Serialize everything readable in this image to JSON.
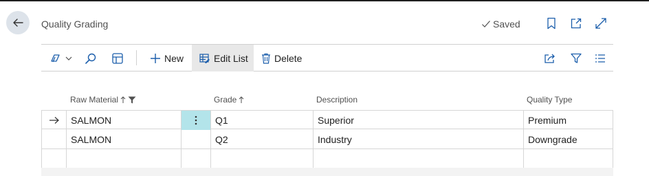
{
  "header": {
    "title": "Quality Grading",
    "saved_label": "Saved"
  },
  "toolbar": {
    "new_label": "New",
    "edit_list_label": "Edit List",
    "delete_label": "Delete"
  },
  "table": {
    "columns": [
      {
        "label": "Raw Material",
        "sort": "asc",
        "filtered": true
      },
      {
        "label": "Grade",
        "sort": "asc",
        "filtered": false
      },
      {
        "label": "Description",
        "sort": "",
        "filtered": false
      },
      {
        "label": "Quality Type",
        "sort": "",
        "filtered": false
      }
    ],
    "rows": [
      {
        "raw_material": "SALMON",
        "grade": "Q1",
        "description": "Superior",
        "quality_type": "Premium",
        "selected": true
      },
      {
        "raw_material": "SALMON",
        "grade": "Q2",
        "description": "Industry",
        "quality_type": "Downgrade",
        "selected": false
      },
      {
        "raw_material": "",
        "grade": "",
        "description": "",
        "quality_type": "",
        "selected": false
      }
    ]
  },
  "colors": {
    "accent_cell": "#b3e4ea",
    "back_button_bg": "#dde3ea",
    "active_tool_bg": "#e8e8e8"
  }
}
